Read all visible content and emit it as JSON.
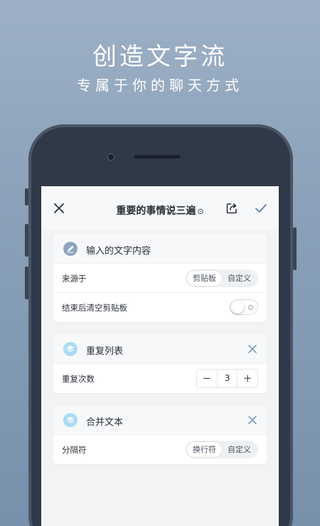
{
  "hero": {
    "title": "创造文字流",
    "subtitle": "专属于你的聊天方式"
  },
  "navbar": {
    "title": "重要的事情说三遍",
    "title_marker": "⊙",
    "close_icon": "close-icon",
    "export_icon": "export-icon",
    "confirm_icon": "check-icon"
  },
  "cards": {
    "input": {
      "title": "输入的文字内容",
      "icon": "pen-icon",
      "icon_color": "#8ea3bd",
      "rows": {
        "source_label": "来源于",
        "source_options": [
          "剪贴板",
          "自定义"
        ],
        "source_selected": "剪贴板",
        "clear_label": "结束后清空剪贴板",
        "clear_enabled": false
      }
    },
    "repeat": {
      "title": "重复列表",
      "icon": "layers-icon",
      "icon_color": "#a9dcf3",
      "rows": {
        "count_label": "重复次数",
        "count_value": "3",
        "minus": "−",
        "plus": "+"
      }
    },
    "merge": {
      "title": "合并文本",
      "icon": "layers-icon",
      "icon_color": "#a9dcf3",
      "rows": {
        "separator_label": "分隔符",
        "separator_options": [
          "换行符",
          "自定义"
        ],
        "separator_selected": "换行符"
      }
    }
  },
  "colors": {
    "accent": "#5b7fa6",
    "background_top": "#9db0c5",
    "phone": "#2f3947"
  }
}
